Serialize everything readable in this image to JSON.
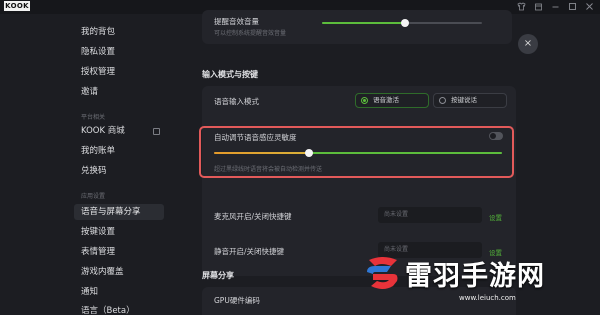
{
  "app": {
    "logo_text": "KOOK"
  },
  "titlebar": {
    "icons": [
      "shirt-icon",
      "box-icon",
      "minimize-icon",
      "maximize-icon",
      "close-icon"
    ]
  },
  "sidebar": {
    "items_top": [
      "我的背包",
      "隐私设置",
      "授权管理",
      "邀请"
    ],
    "section_platform": "平台相关",
    "items_platform": [
      "KOOK 商城",
      "我的账单",
      "兑换码"
    ],
    "section_app": "应用设置",
    "items_app": [
      "语音与屏幕分享",
      "按键设置",
      "表情管理",
      "游戏内覆盖",
      "通知",
      "语言（Beta）"
    ],
    "active_item": "语音与屏幕分享"
  },
  "main": {
    "prompt_volume": {
      "label": "提醒音效音量",
      "desc": "可以控制系统提醒音效音量",
      "value_fraction": 0.52
    },
    "input_mode": {
      "heading": "输入模式与按键",
      "label": "语音输入模式",
      "options": [
        "语音激活",
        "按键说话"
      ],
      "selected": "语音激活"
    },
    "auto_sensitivity": {
      "label": "自动调节语音感应灵敏度",
      "toggle_on": false,
      "desc": "超过黑绿线时语音将会被自动检测并传送",
      "value_fraction": 0.33
    },
    "mic_toggle_key": {
      "label": "麦克风开启/关闭快捷键",
      "placeholder": "尚未设置",
      "set_label": "设置"
    },
    "mute_toggle_key": {
      "label": "静音开启/关闭快捷键",
      "placeholder": "尚未设置",
      "set_label": "设置"
    },
    "screen_share": {
      "heading": "屏幕分享",
      "gpu_label": "GPU硬件编码"
    },
    "close_label": "×"
  },
  "watermark": {
    "title": "雷羽手游网",
    "url": "www.leiuch.com"
  },
  "colors": {
    "accent_green": "#5cbd3c",
    "highlight_red": "#e25a5a",
    "slider_orange": "#e59a2a"
  }
}
